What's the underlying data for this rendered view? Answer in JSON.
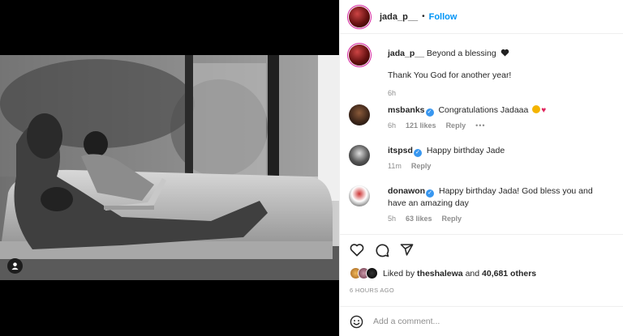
{
  "post": {
    "username": "jada_p__",
    "follow_label": "Follow",
    "separator": "•",
    "caption_line1": "Beyond a blessing",
    "caption_line2": "Thank You God for another year!",
    "caption_time": "6h"
  },
  "comments": [
    {
      "username": "msbanks",
      "text": "Congratulations Jadaaa",
      "time": "6h",
      "likes": "121 likes",
      "reply": "Reply",
      "more": "•••",
      "verified": true
    },
    {
      "username": "itspsd",
      "text": "Happy birthday Jade",
      "time": "11m",
      "reply": "Reply",
      "verified": true
    },
    {
      "username": "donawon",
      "text": "Happy birthday Jada! God bless you and have an amazing day",
      "time": "5h",
      "likes": "63 likes",
      "reply": "Reply",
      "verified": true
    }
  ],
  "likes": {
    "prefix": "Liked by",
    "user": "theshalewa",
    "and": "and",
    "count": "40,681 others"
  },
  "timestamp": "6 HOURS AGO",
  "add_comment": {
    "placeholder": "Add a comment..."
  },
  "colors": {
    "link": "#0095f6",
    "verified": "#3897f0",
    "muted": "#8e8e8e"
  },
  "icons": [
    "heart-icon",
    "comment-icon",
    "share-icon",
    "emoji-icon",
    "user-tag-icon",
    "verified-icon"
  ]
}
